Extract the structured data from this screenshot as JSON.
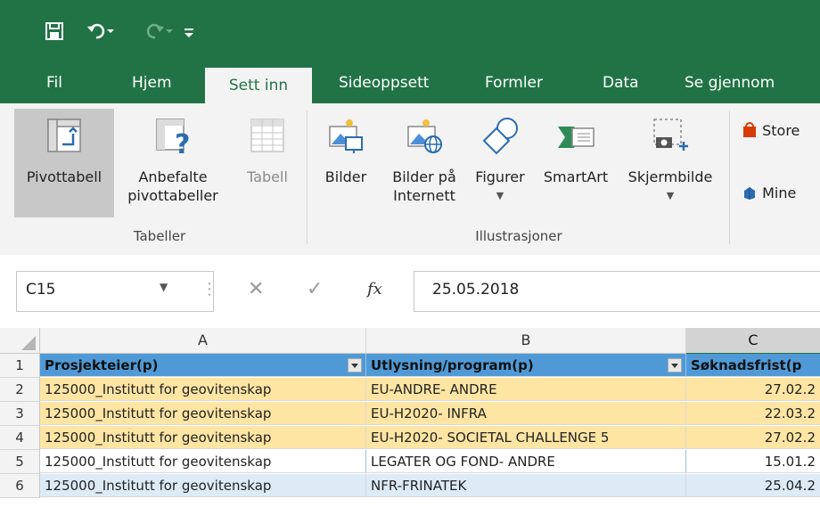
{
  "quick_access": {
    "save_icon": "save-icon",
    "undo_icon": "undo-icon",
    "redo_icon": "redo-icon",
    "customize_icon": "customize-qat-icon"
  },
  "tabs": [
    {
      "label": "Fil"
    },
    {
      "label": "Hjem"
    },
    {
      "label": "Sett inn",
      "active": true
    },
    {
      "label": "Sideoppsett"
    },
    {
      "label": "Formler"
    },
    {
      "label": "Data"
    },
    {
      "label": "Se gjennom"
    }
  ],
  "ribbon": {
    "tabeller": {
      "label": "Tabeller",
      "pivottabell": "Pivottabell",
      "anbefalte_1": "Anbefalte",
      "anbefalte_2": "pivottabeller",
      "tabell": "Tabell"
    },
    "illustrasjoner": {
      "label": "Illustrasjoner",
      "bilder": "Bilder",
      "bilder_internett_1": "Bilder på",
      "bilder_internett_2": "Internett",
      "figurer": "Figurer",
      "smartart": "SmartArt",
      "skjermbilde": "Skjermbilde"
    },
    "addins": {
      "store": "Store",
      "mine": "Mine"
    }
  },
  "formula_bar": {
    "name_box": "C15",
    "fx": "fx",
    "value": "25.05.2018"
  },
  "grid": {
    "columns": [
      "A",
      "B",
      "C"
    ],
    "header_row": {
      "row": "1",
      "a": "Prosjekteier(p)",
      "b": "Utlysning/program(p)",
      "c": "Søknadsfrist(p"
    },
    "rows": [
      {
        "row": "2",
        "a": "125000_Institutt for geovitenskap",
        "b": "EU-ANDRE- ANDRE",
        "c": "27.02.2"
      },
      {
        "row": "3",
        "a": "125000_Institutt for geovitenskap",
        "b": "EU-H2020- INFRA",
        "c": "22.03.2"
      },
      {
        "row": "4",
        "a": "125000_Institutt for geovitenskap",
        "b": "EU-H2020- SOCIETAL CHALLENGE 5",
        "c": "27.02.2"
      },
      {
        "row": "5",
        "a": "125000_Institutt for geovitenskap",
        "b": "LEGATER OG FOND- ANDRE",
        "c": "15.01.2"
      },
      {
        "row": "6",
        "a": "125000_Institutt for geovitenskap",
        "b": "NFR-FRINATEK",
        "c": "25.04.2"
      }
    ]
  },
  "colors": {
    "excel_green": "#217346",
    "header_blue": "#4f9ad6",
    "row_yellow": "#ffe5a3",
    "row_blue": "#ddebf7"
  }
}
